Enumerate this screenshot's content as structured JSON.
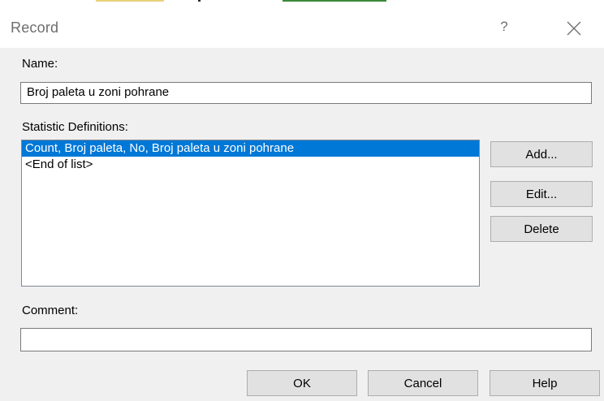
{
  "window": {
    "title": "Record",
    "help_glyph": "?",
    "close_icon": "close-icon"
  },
  "name_field": {
    "label": "Name:",
    "value": "Broj paleta u zoni pohrane"
  },
  "statistic_definitions": {
    "label": "Statistic Definitions:",
    "items": [
      "Count, Broj paleta, No, Broj paleta u zoni pohrane",
      "<End of list>"
    ],
    "selected_index": 0
  },
  "side_buttons": {
    "add": "Add...",
    "edit": "Edit...",
    "delete": "Delete"
  },
  "comment_field": {
    "label": "Comment:",
    "value": ""
  },
  "bottom_buttons": {
    "ok": "OK",
    "cancel": "Cancel",
    "help": "Help"
  },
  "colors": {
    "selection": "#0078d7",
    "dialog_background": "#f0f0f0",
    "button_face": "#e1e1e1"
  }
}
